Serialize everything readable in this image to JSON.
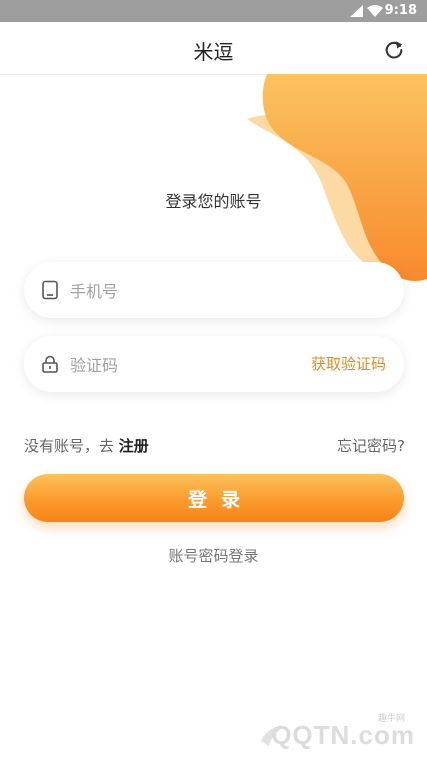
{
  "status_bar": {
    "time": "9:18"
  },
  "app_bar": {
    "title": "米逗",
    "refresh_icon": "refresh-icon"
  },
  "subtitle": "登录您的账号",
  "phone_field": {
    "placeholder": "手机号",
    "value": "",
    "icon": "phone-icon"
  },
  "code_field": {
    "placeholder": "验证码",
    "value": "",
    "icon": "lock-icon",
    "get_code_label": "获取验证码"
  },
  "links": {
    "no_account_text": "没有账号，去",
    "register_label": "注册",
    "forgot_label": "忘记密码?"
  },
  "login_button": {
    "label": "登录"
  },
  "alt_login": {
    "label": "账号密码登录"
  },
  "watermark": {
    "small": "趣牛网",
    "big": "QQTN.com"
  },
  "colors": {
    "accent": "#f98316",
    "accent_light": "#fdc25a",
    "link_orange": "#f08a1c"
  }
}
